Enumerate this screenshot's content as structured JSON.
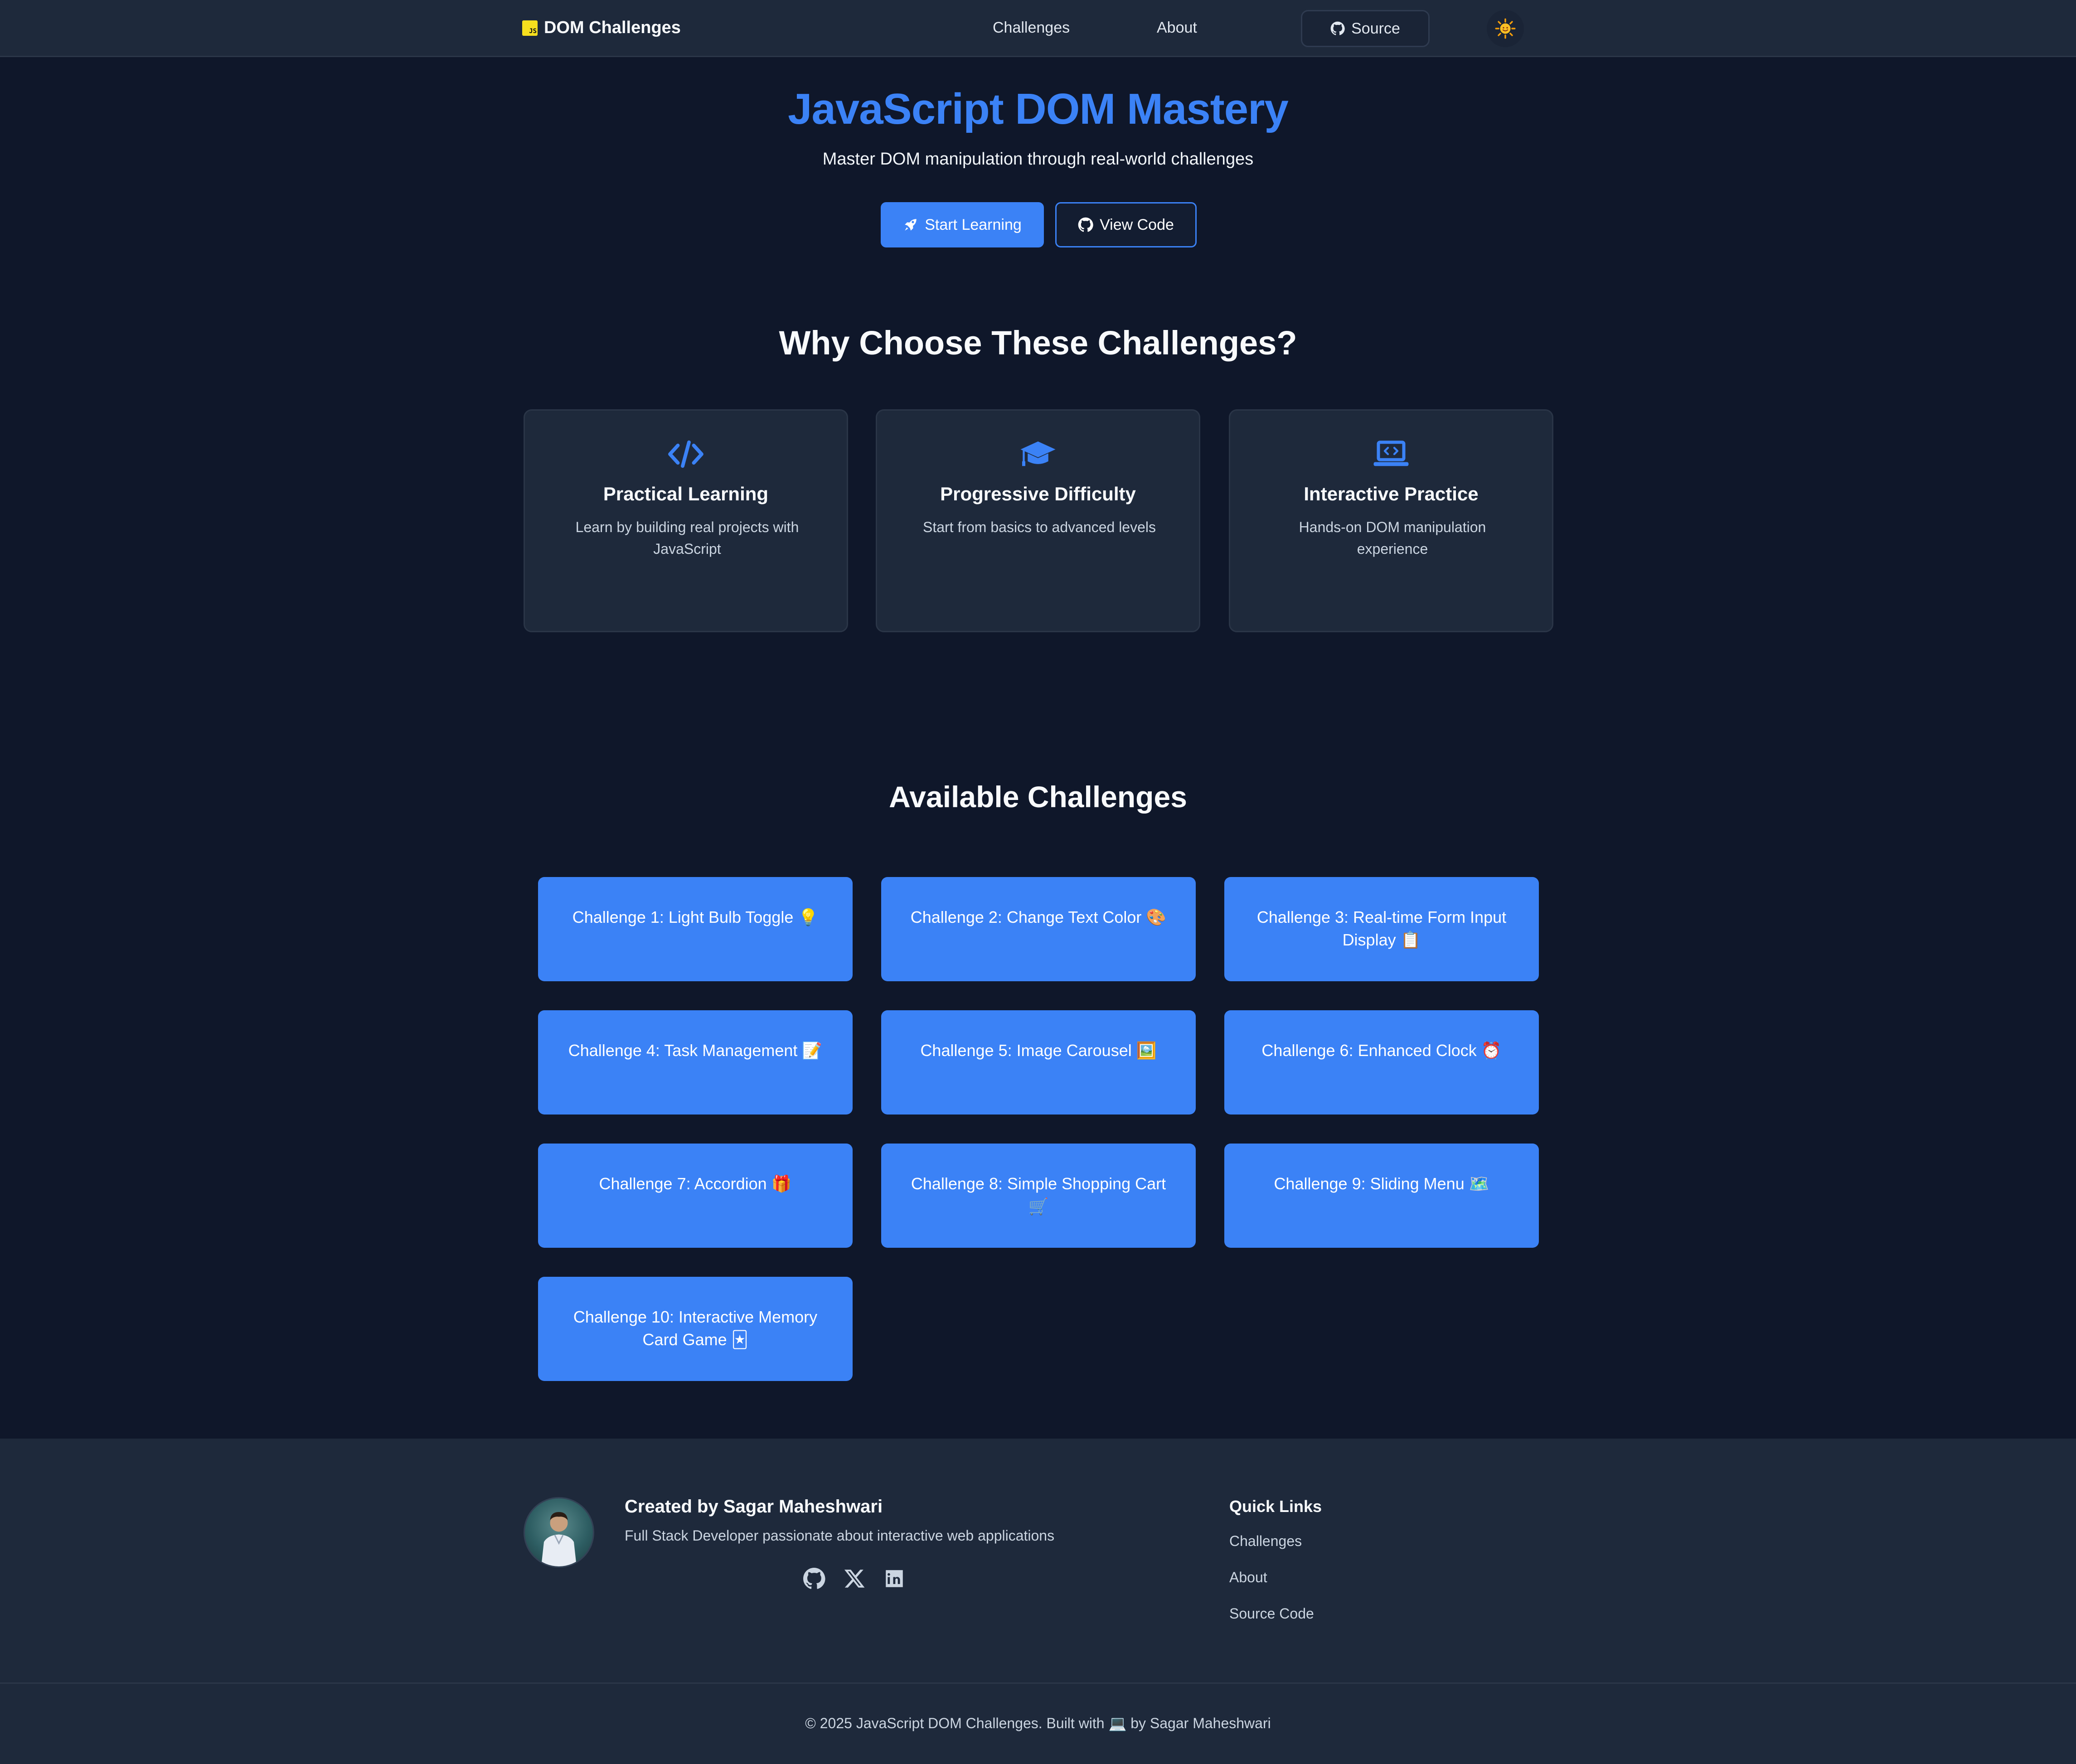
{
  "nav": {
    "brand": "DOM Challenges",
    "brand_logo": "JS",
    "links": [
      "Challenges",
      "About"
    ],
    "source_label": "Source",
    "theme_icon": "sun-icon"
  },
  "hero": {
    "title": "JavaScript DOM Mastery",
    "subtitle": "Master DOM manipulation through real-world challenges",
    "primary_button": "Start Learning",
    "secondary_button": "View Code"
  },
  "why": {
    "title": "Why Choose These Challenges?",
    "features": [
      {
        "icon": "code-icon",
        "title": "Practical Learning",
        "desc": "Learn by building real projects with JavaScript"
      },
      {
        "icon": "graduation-cap-icon",
        "title": "Progressive Difficulty",
        "desc": "Start from basics to advanced levels"
      },
      {
        "icon": "laptop-code-icon",
        "title": "Interactive Practice",
        "desc": "Hands-on DOM manipulation experience"
      }
    ]
  },
  "challenges": {
    "title": "Available Challenges",
    "items": [
      "Challenge 1: Light Bulb Toggle 💡",
      "Challenge 2: Change Text Color 🎨",
      "Challenge 3: Real-time Form Input Display 📋",
      "Challenge 4: Task Management 📝",
      "Challenge 5: Image Carousel 🖼️",
      "Challenge 6: Enhanced Clock ⏰",
      "Challenge 7: Accordion 🎁",
      "Challenge 8: Simple Shopping Cart 🛒",
      "Challenge 9: Sliding Menu 🗺️",
      "Challenge 10: Interactive Memory Card Game 🃏"
    ]
  },
  "footer": {
    "creator": "Created by Sagar Maheshwari",
    "creator_desc": "Full Stack Developer passionate about interactive web applications",
    "quick_links_title": "Quick Links",
    "quick_links": [
      "Challenges",
      "About",
      "Source Code"
    ],
    "copyright": "© 2025 JavaScript DOM Challenges. Built with 💻 by Sagar Maheshwari"
  },
  "colors": {
    "accent": "#3b82f6",
    "background": "#0f172a",
    "surface": "#1e293b"
  }
}
